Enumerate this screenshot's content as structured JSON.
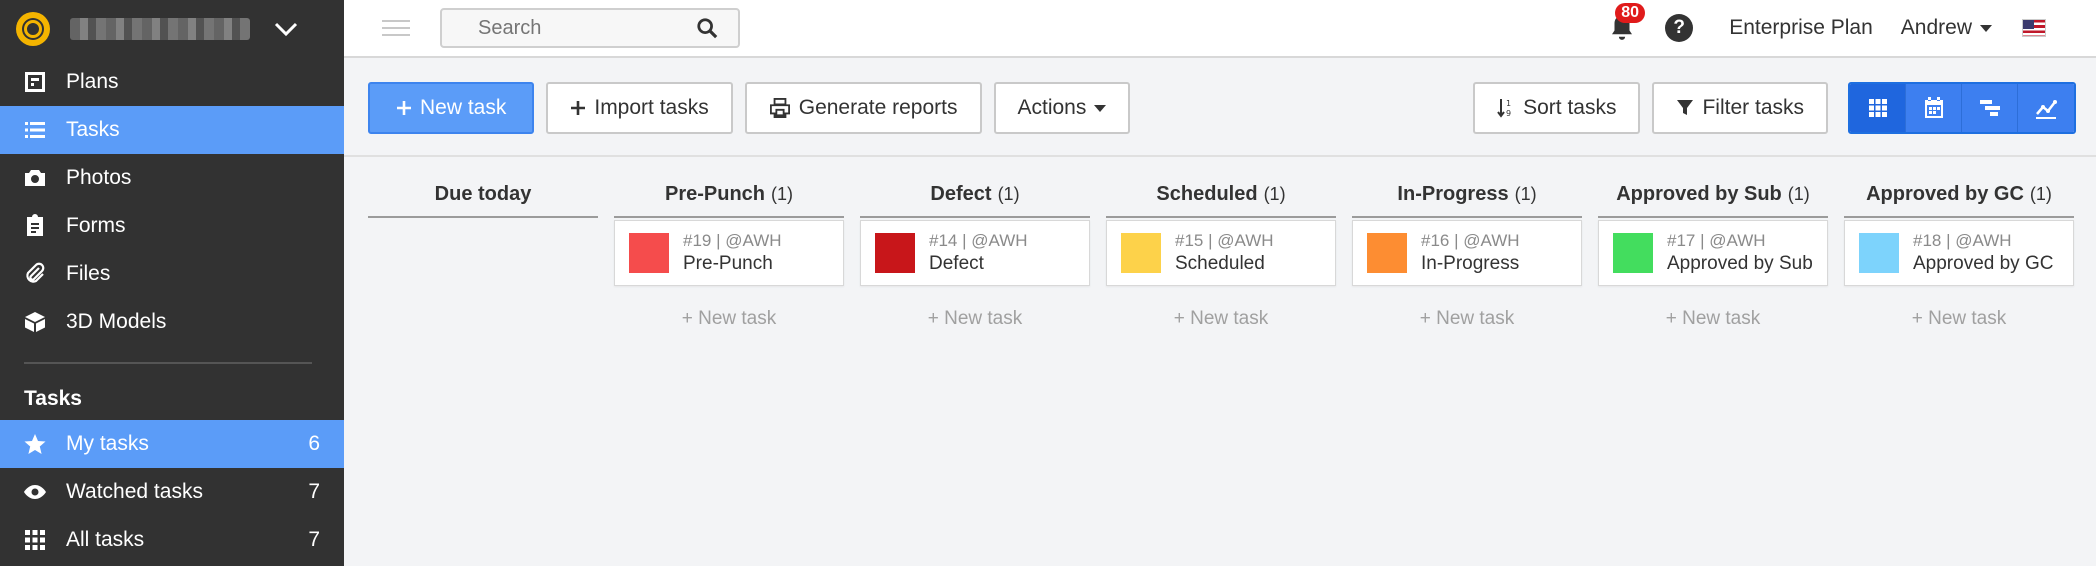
{
  "sidebar": {
    "nav": [
      {
        "label": "Plans",
        "icon": "plans-icon"
      },
      {
        "label": "Tasks",
        "icon": "list-icon",
        "active": true
      },
      {
        "label": "Photos",
        "icon": "camera-icon"
      },
      {
        "label": "Forms",
        "icon": "clipboard-icon"
      },
      {
        "label": "Files",
        "icon": "paperclip-icon"
      },
      {
        "label": "3D Models",
        "icon": "cube-icon"
      }
    ],
    "section_title": "Tasks",
    "task_filters": [
      {
        "label": "My tasks",
        "count": "6",
        "icon": "star-icon",
        "active": true
      },
      {
        "label": "Watched tasks",
        "count": "7",
        "icon": "eye-icon"
      },
      {
        "label": "All tasks",
        "count": "7",
        "icon": "grid-dots-icon"
      }
    ]
  },
  "topbar": {
    "search_placeholder": "Search",
    "notification_count": "80",
    "help_label": "?",
    "plan_label": "Enterprise Plan",
    "user_name": "Andrew"
  },
  "toolbar": {
    "new_task": "New task",
    "import_tasks": "Import tasks",
    "generate_reports": "Generate reports",
    "actions": "Actions",
    "sort_tasks": "Sort tasks",
    "filter_tasks": "Filter tasks",
    "views": [
      "grid-view-icon",
      "calendar-view-icon",
      "gantt-view-icon",
      "chart-view-icon"
    ]
  },
  "colors": {
    "accent": "#5b9cf8",
    "sidebar_bg": "#323232"
  },
  "board": {
    "new_task_link": "+ New task",
    "columns": [
      {
        "title": "Due today",
        "count": "",
        "cards": []
      },
      {
        "title": "Pre-Punch",
        "count": "(1)",
        "cards": [
          {
            "meta": "#19 | @AWH",
            "title": "Pre-Punch",
            "color": "#f54c4c"
          }
        ]
      },
      {
        "title": "Defect",
        "count": "(1)",
        "cards": [
          {
            "meta": "#14 | @AWH",
            "title": "Defect",
            "color": "#c8161a"
          }
        ]
      },
      {
        "title": "Scheduled",
        "count": "(1)",
        "cards": [
          {
            "meta": "#15 | @AWH",
            "title": "Scheduled",
            "color": "#fdd24a"
          }
        ]
      },
      {
        "title": "In-Progress",
        "count": "(1)",
        "cards": [
          {
            "meta": "#16 | @AWH",
            "title": "In-Progress",
            "color": "#fd8d32"
          }
        ]
      },
      {
        "title": "Approved by Sub",
        "count": "(1)",
        "cards": [
          {
            "meta": "#17 | @AWH",
            "title": "Approved by Sub",
            "color": "#43dd5e"
          }
        ]
      },
      {
        "title": "Approved by GC",
        "count": "(1)",
        "cards": [
          {
            "meta": "#18 | @AWH",
            "title": "Approved by GC",
            "color": "#7dd3fc"
          }
        ]
      }
    ]
  }
}
